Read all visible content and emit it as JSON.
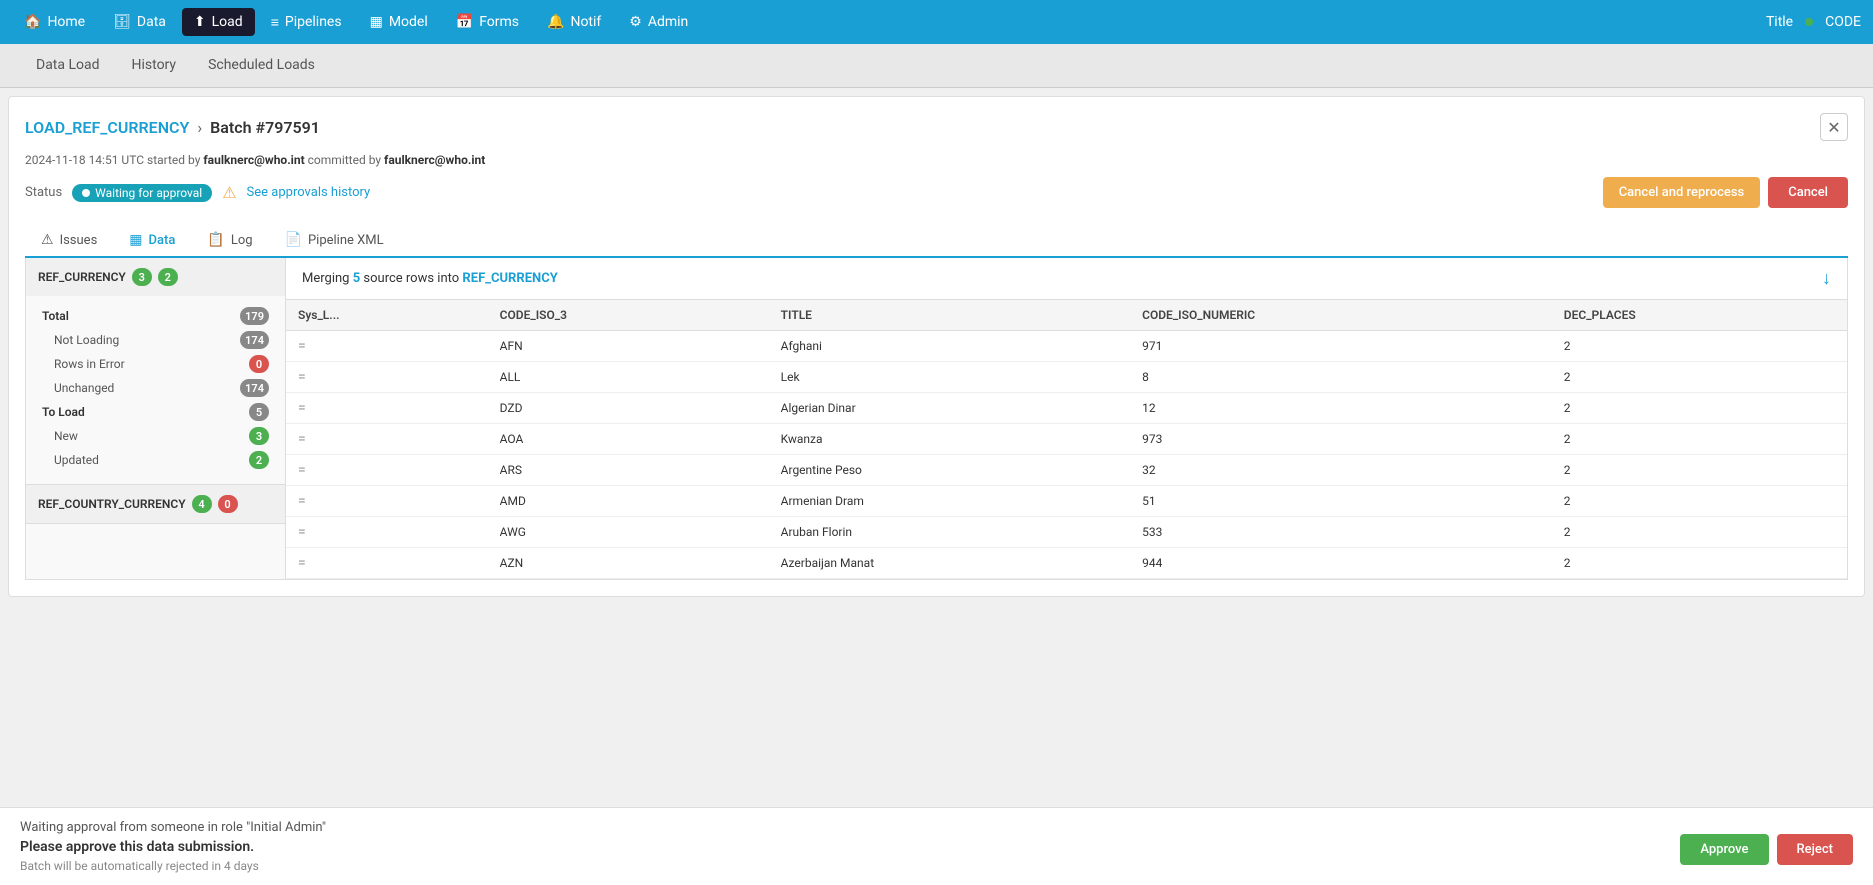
{
  "nav": {
    "items": [
      {
        "label": "Home",
        "icon": "🏠",
        "active": false
      },
      {
        "label": "Data",
        "icon": "🗄",
        "active": false
      },
      {
        "label": "Load",
        "icon": "⬆",
        "active": true
      },
      {
        "label": "Pipelines",
        "icon": "≡",
        "active": false
      },
      {
        "label": "Model",
        "icon": "▦",
        "active": false
      },
      {
        "label": "Forms",
        "icon": "📅",
        "active": false
      },
      {
        "label": "Notif",
        "icon": "🔔",
        "active": false
      },
      {
        "label": "Admin",
        "icon": "⚙",
        "active": false
      }
    ],
    "right_title": "Title",
    "right_code": "CODE"
  },
  "subnav": {
    "items": [
      {
        "label": "Data Load",
        "active": false
      },
      {
        "label": "History",
        "active": false
      },
      {
        "label": "Scheduled Loads",
        "active": false
      }
    ]
  },
  "breadcrumb": {
    "link_text": "LOAD_REF_CURRENCY",
    "chevron": "›",
    "current": "Batch #797591",
    "close_icon": "✕"
  },
  "meta": {
    "date": "2024-11-18 14:51 UTC",
    "started_by_label": "started by",
    "started_by": "faulknerc@who.int",
    "committed_by_label": "committed by",
    "committed_by": "faulknerc@who.int"
  },
  "status": {
    "label": "Status",
    "badge_text": "Waiting for approval",
    "approvals_link": "See approvals history",
    "warning_icon": "⚠"
  },
  "actions": {
    "cancel_reprocess": "Cancel and reprocess",
    "cancel": "Cancel"
  },
  "tabs": [
    {
      "label": "Issues",
      "icon": "⚠",
      "active": false
    },
    {
      "label": "Data",
      "icon": "▦",
      "active": true
    },
    {
      "label": "Log",
      "icon": "📋",
      "active": false
    },
    {
      "label": "Pipeline XML",
      "icon": "📄",
      "active": false
    }
  ],
  "left_panel": {
    "sections": [
      {
        "name": "REF_CURRENCY",
        "badges": [
          {
            "value": "3",
            "color": "green"
          },
          {
            "value": "2",
            "color": "green"
          }
        ],
        "stats": [
          {
            "label": "Total",
            "badge": "179",
            "badge_color": "gray",
            "indent": 0,
            "bold": true
          },
          {
            "label": "Not Loading",
            "badge": "174",
            "badge_color": "gray",
            "indent": 1,
            "bold": false
          },
          {
            "label": "Rows in Error",
            "badge": "0",
            "badge_color": "red",
            "indent": 1,
            "bold": false
          },
          {
            "label": "Unchanged",
            "badge": "174",
            "badge_color": "gray",
            "indent": 1,
            "bold": false
          },
          {
            "label": "To Load",
            "badge": "5",
            "badge_color": "gray",
            "indent": 0,
            "bold": true
          },
          {
            "label": "New",
            "badge": "3",
            "badge_color": "green",
            "indent": 1,
            "bold": false
          },
          {
            "label": "Updated",
            "badge": "2",
            "badge_color": "green",
            "indent": 1,
            "bold": false
          }
        ]
      },
      {
        "name": "REF_COUNTRY_CURRENCY",
        "badges": [
          {
            "value": "4",
            "color": "green"
          },
          {
            "value": "0",
            "color": "red"
          }
        ],
        "stats": []
      }
    ]
  },
  "right_panel": {
    "merge_prefix": "Merging",
    "merge_count": "5",
    "merge_middle": "source rows into",
    "merge_target": "REF_CURRENCY",
    "download_icon": "↓",
    "table": {
      "columns": [
        "Sys_L...",
        "CODE_ISO_3",
        "TITLE",
        "CODE_ISO_NUMERIC",
        "DEC_PLACES"
      ],
      "rows": [
        {
          "sys": "=",
          "code_iso_3": "AFN",
          "title": "Afghani",
          "code_iso_numeric": "971",
          "dec_places": "2"
        },
        {
          "sys": "=",
          "code_iso_3": "ALL",
          "title": "Lek",
          "code_iso_numeric": "8",
          "dec_places": "2"
        },
        {
          "sys": "=",
          "code_iso_3": "DZD",
          "title": "Algerian Dinar",
          "code_iso_numeric": "12",
          "dec_places": "2"
        },
        {
          "sys": "=",
          "code_iso_3": "AOA",
          "title": "Kwanza",
          "code_iso_numeric": "973",
          "dec_places": "2"
        },
        {
          "sys": "=",
          "code_iso_3": "ARS",
          "title": "Argentine Peso",
          "code_iso_numeric": "32",
          "dec_places": "2"
        },
        {
          "sys": "=",
          "code_iso_3": "AMD",
          "title": "Armenian Dram",
          "code_iso_numeric": "51",
          "dec_places": "2"
        },
        {
          "sys": "=",
          "code_iso_3": "AWG",
          "title": "Aruban Florin",
          "code_iso_numeric": "533",
          "dec_places": "2"
        },
        {
          "sys": "=",
          "code_iso_3": "AZN",
          "title": "Azerbaijan Manat",
          "code_iso_numeric": "944",
          "dec_places": "2"
        }
      ]
    }
  },
  "bottom_bar": {
    "waiting_text": "Waiting approval from someone in role \"Initial Admin\"",
    "title": "Please approve this data submission.",
    "note": "Batch will be automatically rejected in 4 days",
    "approve_btn": "Approve",
    "reject_btn": "Reject"
  }
}
